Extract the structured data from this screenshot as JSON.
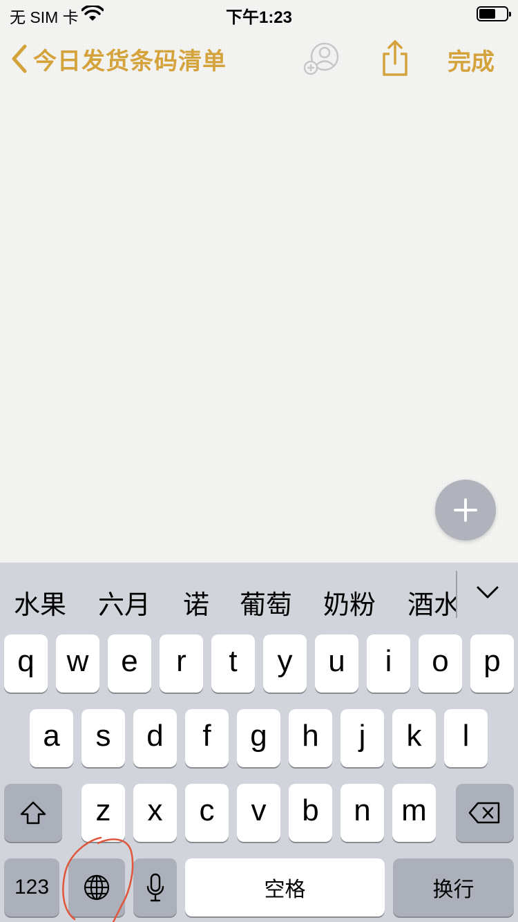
{
  "status_bar": {
    "carrier": "无 SIM 卡",
    "time": "下午1:23",
    "battery_level": 0.6
  },
  "nav": {
    "back_label": "今日发货条码清单",
    "done_label": "完成"
  },
  "keyboard": {
    "candidates": [
      "水果",
      "六月",
      "诺",
      "葡萄",
      "奶粉",
      "酒水"
    ],
    "row1": [
      "q",
      "w",
      "e",
      "r",
      "t",
      "y",
      "u",
      "i",
      "o",
      "p"
    ],
    "row2": [
      "a",
      "s",
      "d",
      "f",
      "g",
      "h",
      "j",
      "k",
      "l"
    ],
    "row3": [
      "z",
      "x",
      "c",
      "v",
      "b",
      "n",
      "m"
    ],
    "numbers_label": "123",
    "space_label": "空格",
    "return_label": "换行"
  },
  "colors": {
    "accent": "#d4a33b",
    "annotation": "#e0553a",
    "keyboard_bg": "#d1d4db"
  }
}
